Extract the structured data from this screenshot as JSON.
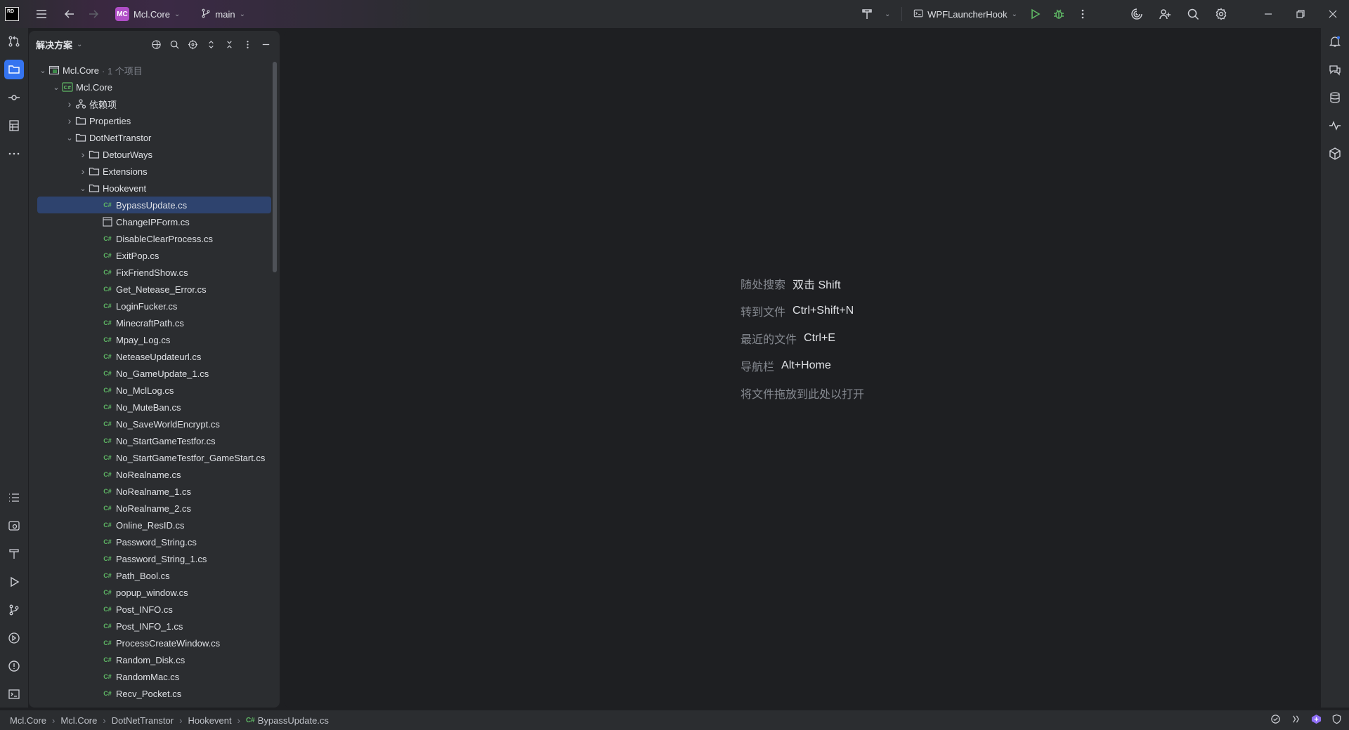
{
  "titlebar": {
    "app_logo": "RD",
    "project_badge": "MC",
    "project_name": "Mcl.Core",
    "branch": "main",
    "run_config": "WPFLauncherHook"
  },
  "panel": {
    "title": "解决方案"
  },
  "tree": [
    {
      "label": "Mcl.Core",
      "suffix": "· 1 个项目",
      "level": 0,
      "arrow": "open",
      "icon": "solution-icon"
    },
    {
      "label": "Mcl.Core",
      "level": 1,
      "arrow": "open",
      "icon": "csproj-icon"
    },
    {
      "label": "依赖项",
      "level": 2,
      "arrow": "closed",
      "icon": "dependencies-icon"
    },
    {
      "label": "Properties",
      "level": 2,
      "arrow": "closed",
      "icon": "folder-icon"
    },
    {
      "label": "DotNetTranstor",
      "level": 2,
      "arrow": "open",
      "icon": "folder-icon"
    },
    {
      "label": "DetourWays",
      "level": 3,
      "arrow": "closed",
      "icon": "folder-icon"
    },
    {
      "label": "Extensions",
      "level": 3,
      "arrow": "closed",
      "icon": "folder-icon"
    },
    {
      "label": "Hookevent",
      "level": 3,
      "arrow": "open",
      "icon": "folder-icon"
    },
    {
      "label": "BypassUpdate.cs",
      "level": 4,
      "icon": "csharp-file-icon",
      "selected": true
    },
    {
      "label": "ChangeIPForm.cs",
      "level": 4,
      "icon": "form-file-icon"
    },
    {
      "label": "DisableClearProcess.cs",
      "level": 4,
      "icon": "csharp-file-icon"
    },
    {
      "label": "ExitPop.cs",
      "level": 4,
      "icon": "csharp-file-icon"
    },
    {
      "label": "FixFriendShow.cs",
      "level": 4,
      "icon": "csharp-file-icon"
    },
    {
      "label": "Get_Netease_Error.cs",
      "level": 4,
      "icon": "csharp-file-icon"
    },
    {
      "label": "LoginFucker.cs",
      "level": 4,
      "icon": "csharp-file-icon"
    },
    {
      "label": "MinecraftPath.cs",
      "level": 4,
      "icon": "csharp-file-icon"
    },
    {
      "label": "Mpay_Log.cs",
      "level": 4,
      "icon": "csharp-file-icon"
    },
    {
      "label": "NeteaseUpdateurl.cs",
      "level": 4,
      "icon": "csharp-file-icon"
    },
    {
      "label": "No_GameUpdate_1.cs",
      "level": 4,
      "icon": "csharp-file-icon"
    },
    {
      "label": "No_MclLog.cs",
      "level": 4,
      "icon": "csharp-file-icon"
    },
    {
      "label": "No_MuteBan.cs",
      "level": 4,
      "icon": "csharp-file-icon"
    },
    {
      "label": "No_SaveWorldEncrypt.cs",
      "level": 4,
      "icon": "csharp-file-icon"
    },
    {
      "label": "No_StartGameTestfor.cs",
      "level": 4,
      "icon": "csharp-file-icon"
    },
    {
      "label": "No_StartGameTestfor_GameStart.cs",
      "level": 4,
      "icon": "csharp-file-icon"
    },
    {
      "label": "NoRealname.cs",
      "level": 4,
      "icon": "csharp-file-icon"
    },
    {
      "label": "NoRealname_1.cs",
      "level": 4,
      "icon": "csharp-file-icon"
    },
    {
      "label": "NoRealname_2.cs",
      "level": 4,
      "icon": "csharp-file-icon"
    },
    {
      "label": "Online_ResID.cs",
      "level": 4,
      "icon": "csharp-file-icon"
    },
    {
      "label": "Password_String.cs",
      "level": 4,
      "icon": "csharp-file-icon"
    },
    {
      "label": "Password_String_1.cs",
      "level": 4,
      "icon": "csharp-file-icon"
    },
    {
      "label": "Path_Bool.cs",
      "level": 4,
      "icon": "csharp-file-icon"
    },
    {
      "label": "popup_window.cs",
      "level": 4,
      "icon": "csharp-file-icon"
    },
    {
      "label": "Post_INFO.cs",
      "level": 4,
      "icon": "csharp-file-icon"
    },
    {
      "label": "Post_INFO_1.cs",
      "level": 4,
      "icon": "csharp-file-icon"
    },
    {
      "label": "ProcessCreateWindow.cs",
      "level": 4,
      "icon": "csharp-file-icon"
    },
    {
      "label": "Random_Disk.cs",
      "level": 4,
      "icon": "csharp-file-icon"
    },
    {
      "label": "RandomMac.cs",
      "level": 4,
      "icon": "csharp-file-icon"
    },
    {
      "label": "Recv_Pocket.cs",
      "level": 4,
      "icon": "csharp-file-icon"
    }
  ],
  "editor_hints": [
    {
      "label": "随处搜索",
      "key": "双击 Shift"
    },
    {
      "label": "转到文件",
      "key": "Ctrl+Shift+N"
    },
    {
      "label": "最近的文件",
      "key": "Ctrl+E"
    },
    {
      "label": "导航栏",
      "key": "Alt+Home"
    },
    {
      "label": "将文件拖放到此处以打开",
      "key": ""
    }
  ],
  "statusbar": {
    "breadcrumbs": [
      "Mcl.Core",
      "Mcl.Core",
      "DotNetTranstor",
      "Hookevent"
    ],
    "current_file_icon": "C#",
    "current_file": "BypassUpdate.cs"
  }
}
